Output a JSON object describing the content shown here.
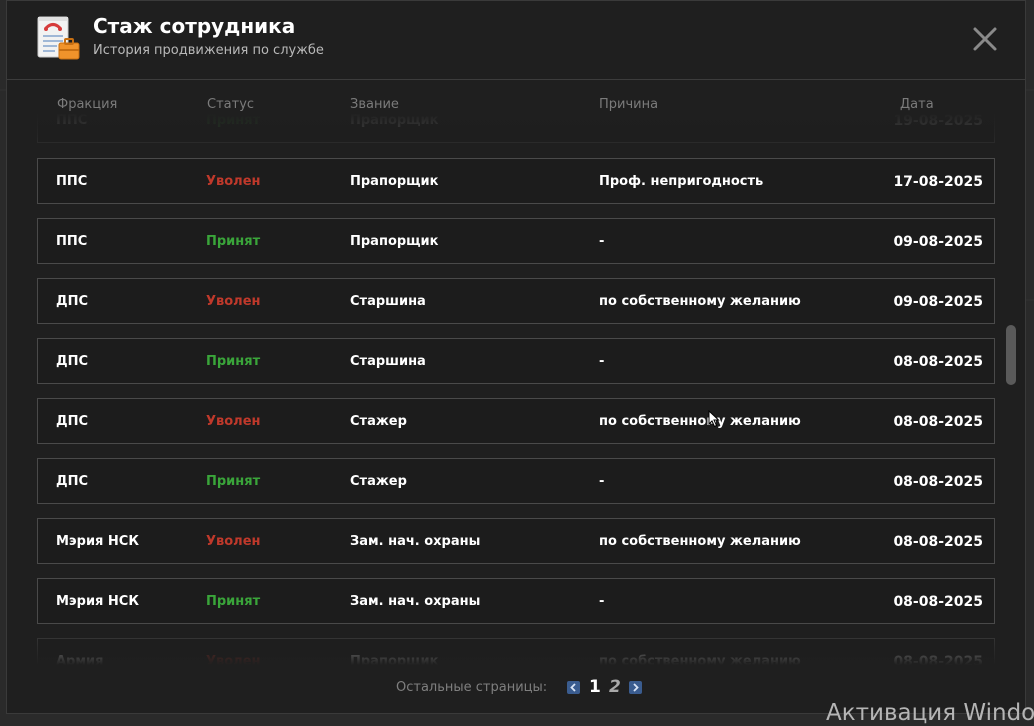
{
  "header": {
    "title": "Стаж сотрудника",
    "subtitle": "История продвижения по службе",
    "app_icon": "document-briefcase-icon",
    "close_icon": "close-icon"
  },
  "columns": {
    "faction": "Фракция",
    "status": "Статус",
    "rank": "Звание",
    "reason": "Причина",
    "date": "Дата"
  },
  "rows": [
    {
      "faction": "ППС",
      "status": "Принят",
      "status_type": "hired",
      "rank": "Прапорщик",
      "reason": "",
      "date": "19-08-2025",
      "clipped": true
    },
    {
      "faction": "ППС",
      "status": "Уволен",
      "status_type": "fired",
      "rank": "Прапорщик",
      "reason": "Проф. непригодность",
      "date": "17-08-2025"
    },
    {
      "faction": "ППС",
      "status": "Принят",
      "status_type": "hired",
      "rank": "Прапорщик",
      "reason": "-",
      "date": "09-08-2025"
    },
    {
      "faction": "ДПС",
      "status": "Уволен",
      "status_type": "fired",
      "rank": "Старшина",
      "reason": "по собственному желанию",
      "date": "09-08-2025"
    },
    {
      "faction": "ДПС",
      "status": "Принят",
      "status_type": "hired",
      "rank": "Старшина",
      "reason": "-",
      "date": "08-08-2025"
    },
    {
      "faction": "ДПС",
      "status": "Уволен",
      "status_type": "fired",
      "rank": "Стажер",
      "reason": "по собственному желанию",
      "date": "08-08-2025"
    },
    {
      "faction": "ДПС",
      "status": "Принят",
      "status_type": "hired",
      "rank": "Стажер",
      "reason": "-",
      "date": "08-08-2025"
    },
    {
      "faction": "Мэрия НСК",
      "status": "Уволен",
      "status_type": "fired",
      "rank": "Зам. нач. охраны",
      "reason": "по собственному желанию",
      "date": "08-08-2025"
    },
    {
      "faction": "Мэрия НСК",
      "status": "Принят",
      "status_type": "hired",
      "rank": "Зам. нач. охраны",
      "reason": "-",
      "date": "08-08-2025"
    },
    {
      "faction": "Армия",
      "status": "Уволен",
      "status_type": "fired",
      "rank": "Прапорщик",
      "reason": "по собственному желанию",
      "date": "08-08-2025",
      "clipped": true
    }
  ],
  "pagination": {
    "label": "Остальные страницы:",
    "pages": [
      "1",
      "2"
    ],
    "current": "1",
    "prev_icon": "chevron-left-icon",
    "next_icon": "chevron-right-icon"
  },
  "watermark": "Активация Windo",
  "colors": {
    "fired": "#c0392b",
    "hired": "#3aa53a",
    "panel": "#1f1f1f",
    "row_border": "#4a4a4a",
    "accent": "#3a5c8f"
  }
}
